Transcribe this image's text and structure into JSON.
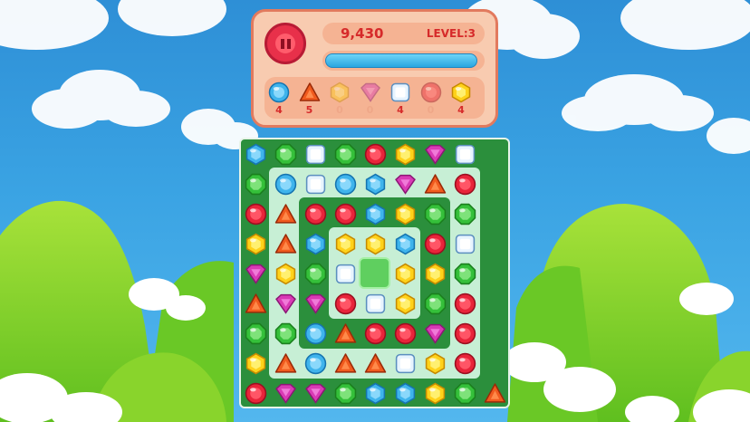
{
  "hud": {
    "score": "9,430",
    "level_label": "LEVEL:3",
    "progress": 0.97,
    "goals": [
      {
        "gem": "blue-circle",
        "count": "4",
        "done": false
      },
      {
        "gem": "red-triangle",
        "count": "5",
        "done": false
      },
      {
        "gem": "yellow-hexagon",
        "count": "0",
        "done": true
      },
      {
        "gem": "pink-diamond",
        "count": "0",
        "done": true
      },
      {
        "gem": "white-square",
        "count": "4",
        "done": false
      },
      {
        "gem": "red-circle",
        "count": "0",
        "done": true
      },
      {
        "gem": "yellow-hexagon",
        "count": "4",
        "done": false
      }
    ]
  },
  "board": {
    "grid": [
      [
        "blue-hex",
        "green-oct",
        "white-square",
        "green-oct",
        "red-circle",
        "yellow-hex",
        "pink-diamond",
        "white-square"
      ],
      [
        "green-oct",
        "blue-circle",
        "white-square",
        "blue-circle",
        "blue-hex",
        "pink-diamond",
        "red-triangle",
        "red-circle"
      ],
      [
        "red-circle",
        "red-triangle",
        "red-circle",
        "red-circle",
        "blue-hex",
        "yellow-hex",
        "green-oct",
        "green-oct"
      ],
      [
        "yellow-hex",
        "red-triangle",
        "blue-hex",
        "yellow-hex",
        "yellow-hex",
        "blue-hex",
        "red-circle",
        "white-square"
      ],
      [
        "pink-diamond",
        "yellow-hex",
        "green-oct",
        "white-square",
        "empty",
        "yellow-hex",
        "yellow-hex",
        "green-oct"
      ],
      [
        "red-triangle",
        "pink-diamond",
        "pink-diamond",
        "red-circle",
        "white-square",
        "yellow-hex",
        "green-oct",
        "red-circle"
      ],
      [
        "green-oct",
        "green-oct",
        "blue-circle",
        "red-triangle",
        "red-circle",
        "red-circle",
        "pink-diamond",
        "red-circle"
      ],
      [
        "yellow-hex",
        "red-triangle",
        "blue-circle",
        "red-triangle",
        "red-triangle",
        "white-square",
        "yellow-hex",
        "red-circle"
      ]
    ],
    "bottom_row": [
      "red-circle",
      "pink-diamond",
      "pink-diamond",
      "green-oct",
      "blue-hex",
      "blue-hex",
      "yellow-hex",
      "green-oct",
      "red-triangle"
    ]
  },
  "colors": {
    "red": "#e8243a",
    "blue": "#3fb4ec",
    "green": "#35c03a",
    "yellow": "#ffd21a",
    "pink": "#d93ab5",
    "white": "#e7f4ff",
    "orange": "#f05a1e"
  }
}
